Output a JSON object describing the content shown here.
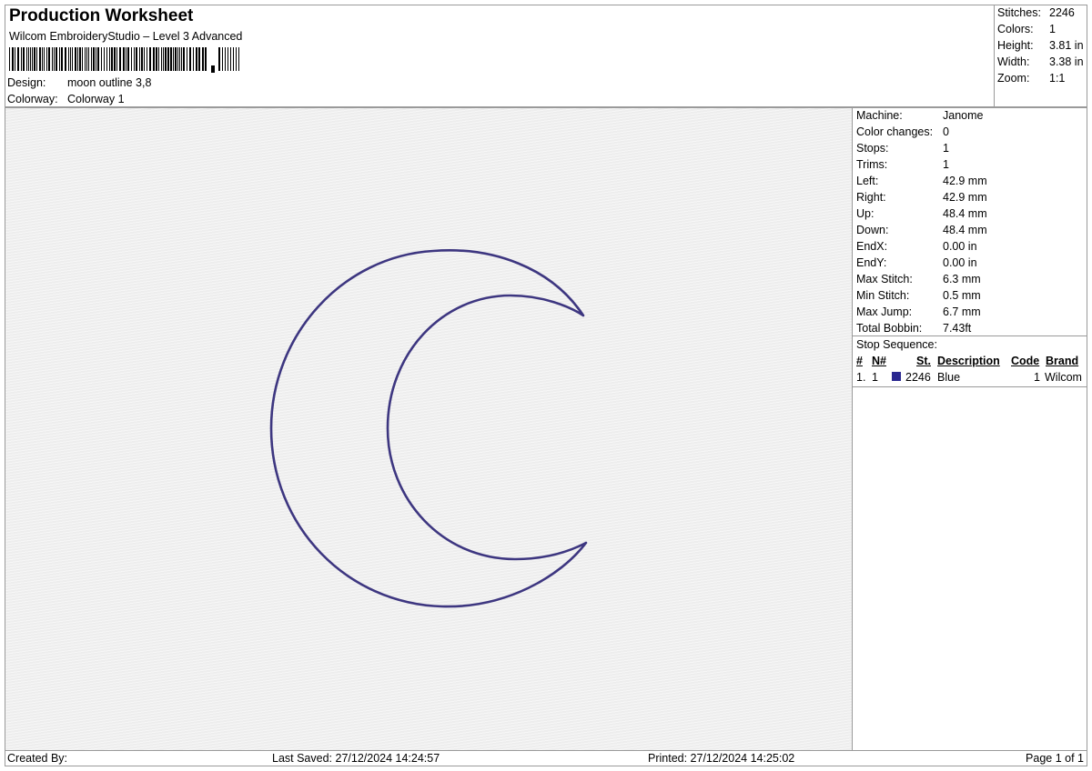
{
  "header": {
    "title": "Production Worksheet",
    "subtitle": "Wilcom EmbroideryStudio – Level 3 Advanced",
    "design_label": "Design:",
    "design_value": "moon outline 3,8",
    "colorway_label": "Colorway:",
    "colorway_value": "Colorway 1"
  },
  "summary": {
    "stitches_label": "Stitches:",
    "stitches_value": "2246",
    "colors_label": "Colors:",
    "colors_value": "1",
    "height_label": "Height:",
    "height_value": "3.81 in",
    "width_label": "Width:",
    "width_value": "3.38 in",
    "zoom_label": "Zoom:",
    "zoom_value": "1:1"
  },
  "properties": [
    {
      "label": "Machine:",
      "value": "Janome"
    },
    {
      "label": "Color changes:",
      "value": "0"
    },
    {
      "label": "Stops:",
      "value": "1"
    },
    {
      "label": "Trims:",
      "value": "1"
    },
    {
      "label": "Left:",
      "value": "42.9 mm"
    },
    {
      "label": "Right:",
      "value": "42.9 mm"
    },
    {
      "label": "Up:",
      "value": "48.4 mm"
    },
    {
      "label": "Down:",
      "value": "48.4 mm"
    },
    {
      "label": "EndX:",
      "value": "0.00 in"
    },
    {
      "label": "EndY:",
      "value": "0.00 in"
    },
    {
      "label": "Max Stitch:",
      "value": "6.3 mm"
    },
    {
      "label": "Min Stitch:",
      "value": "0.5 mm"
    },
    {
      "label": "Max Jump:",
      "value": "6.7 mm"
    },
    {
      "label": "Total Bobbin:",
      "value": "7.43ft"
    }
  ],
  "stop_sequence": {
    "title": "Stop Sequence:",
    "headers": {
      "num": "#",
      "needle": "N#",
      "stitches": "St.",
      "description": "Description",
      "code": "Code",
      "brand": "Brand"
    },
    "rows": [
      {
        "num": "1.",
        "needle": "1",
        "stitches": "2246",
        "description": "Blue",
        "code": "1",
        "brand": "Wilcom",
        "color": "#2a2790"
      }
    ]
  },
  "design_colors": {
    "outline": "#3d3680"
  },
  "footer": {
    "created_by": "Created By:",
    "last_saved": "Last Saved: 27/12/2024 14:24:57",
    "printed": "Printed: 27/12/2024 14:25:02",
    "page": "Page 1 of 1"
  }
}
